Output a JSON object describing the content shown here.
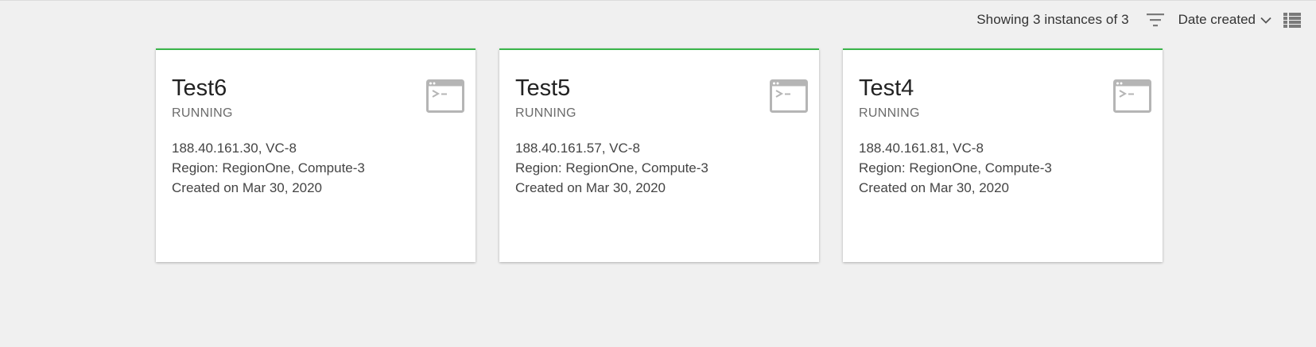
{
  "toolbar": {
    "count_text": "Showing 3 instances of 3",
    "filter_icon": "filter-icon",
    "sort_label": "Date created",
    "sort_icon": "chevron-down-icon",
    "view_icon": "list-view-icon"
  },
  "colors": {
    "accent": "#3ab54a",
    "background": "#f0f0f0",
    "icon_gray": "#b5b5b5"
  },
  "instances": [
    {
      "name": "Test6",
      "status": "RUNNING",
      "address": "188.40.161.30, VC-8",
      "region": "Region: RegionOne, Compute-3",
      "created": "Created on Mar 30, 2020",
      "icon": "terminal-icon"
    },
    {
      "name": "Test5",
      "status": "RUNNING",
      "address": "188.40.161.57, VC-8",
      "region": "Region: RegionOne, Compute-3",
      "created": "Created on Mar 30, 2020",
      "icon": "terminal-icon"
    },
    {
      "name": "Test4",
      "status": "RUNNING",
      "address": "188.40.161.81, VC-8",
      "region": "Region: RegionOne, Compute-3",
      "created": "Created on Mar 30, 2020",
      "icon": "terminal-icon"
    }
  ]
}
